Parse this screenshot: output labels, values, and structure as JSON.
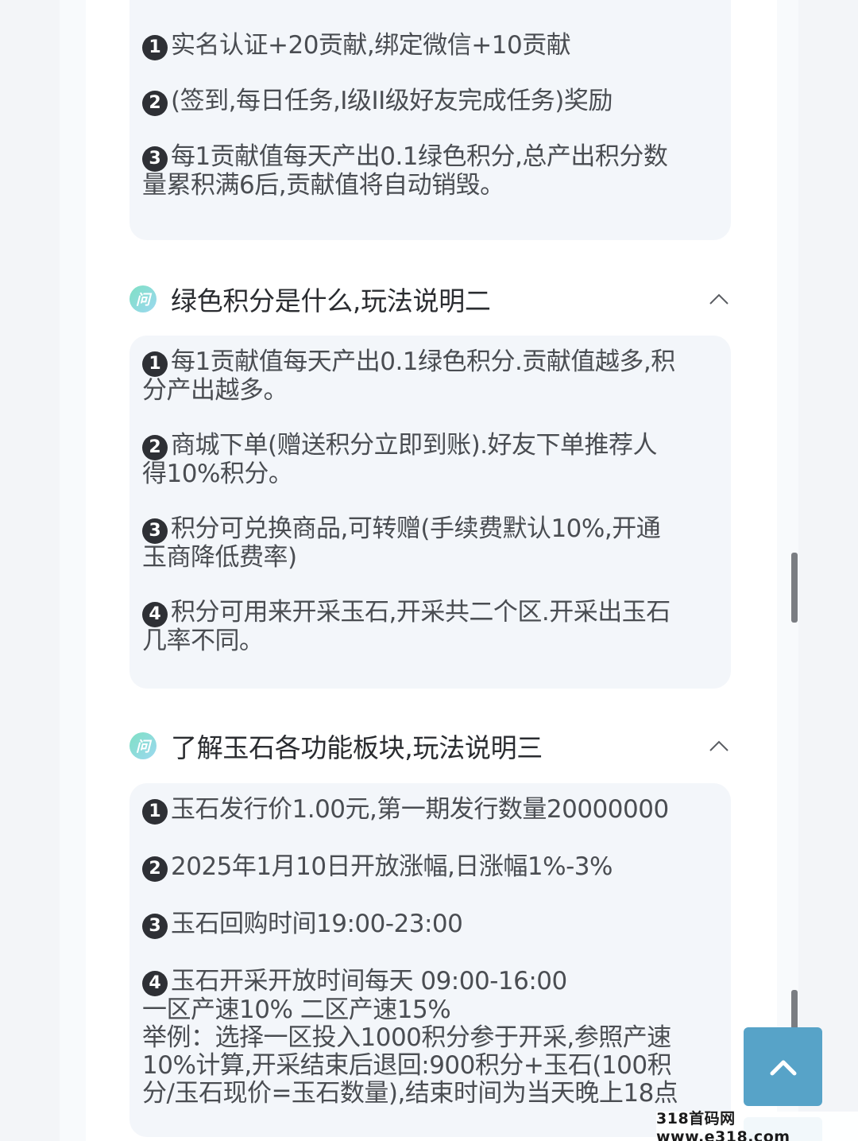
{
  "card1": {
    "items": [
      {
        "num": "1",
        "text": "实名认证+20贡献,绑定微信+10贡献"
      },
      {
        "num": "2",
        "text": "(签到,每日任务,I级II级好友完成任务)奖励"
      },
      {
        "num": "3",
        "text": "每1贡献值每天产出0.1绿色积分,总产出积分数\n量累积满6后,贡献值将自动销毁。"
      }
    ]
  },
  "section2": {
    "icon_text": "问",
    "title": "绿色积分是什么,玩法说明二",
    "items": [
      {
        "num": "1",
        "text": "每1贡献值每天产出0.1绿色积分.贡献值越多,积\n分产出越多。"
      },
      {
        "num": "2",
        "text": "商城下单(赠送积分立即到账).好友下单推荐人\n得10%积分。"
      },
      {
        "num": "3",
        "text": "积分可兑换商品,可转赠(手续费默认10%,开通\n玉商降低费率)"
      },
      {
        "num": "4",
        "text": "积分可用来开采玉石,开采共二个区.开采出玉石\n几率不同。"
      }
    ]
  },
  "section3": {
    "icon_text": "问",
    "title": "了解玉石各功能板块,玩法说明三",
    "items": [
      {
        "num": "1",
        "text": "玉石发行价1.00元,第一期发行数量20000000"
      },
      {
        "num": "2",
        "text": "2025年1月10日开放涨幅,日涨幅1%-3%"
      },
      {
        "num": "3",
        "text": "玉石回购时间19:00-23:00"
      },
      {
        "num": "4",
        "text": "玉石开采开放时间每天 09:00-16:00\n一区产速10% 二区产速15%\n举例：选择一区投入1000积分参于开采,参照产速\n10%计算,开采结束后退回:900积分+玉石(100积\n分/玉石现价=玉石数量),结束时间为当天晚上18点"
      }
    ]
  },
  "watermark": "318首码网 www.e318.com",
  "colors": {
    "accent": "#57a3c8",
    "card_bg": "#f3f6fa",
    "icon_gradient_start": "#7fe0c4",
    "icon_gradient_end": "#9cd8f0"
  }
}
